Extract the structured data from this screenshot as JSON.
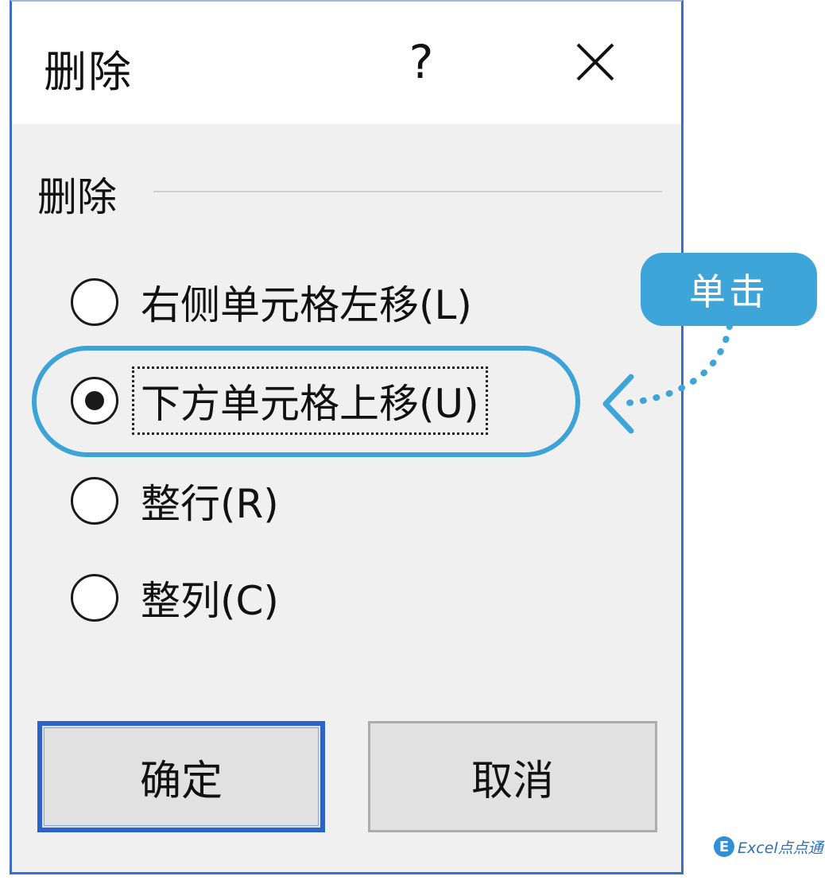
{
  "dialog": {
    "title": "删除",
    "help_label": "?",
    "group_label": "删除",
    "options": [
      {
        "label": "右侧单元格左移(L)",
        "checked": false
      },
      {
        "label": "下方单元格上移(U)",
        "checked": true
      },
      {
        "label": "整行(R)",
        "checked": false
      },
      {
        "label": "整列(C)",
        "checked": false
      }
    ],
    "ok_label": "确定",
    "cancel_label": "取消"
  },
  "annotation": {
    "callout_text": "单击",
    "color": "#3ea5d9"
  },
  "watermark": {
    "logo_letter": "E",
    "text": "Excel点点通"
  },
  "colors": {
    "focus_border": "#2b63c9",
    "dialog_border": "#3a6fc4",
    "body_bg": "#f0f0f0"
  }
}
